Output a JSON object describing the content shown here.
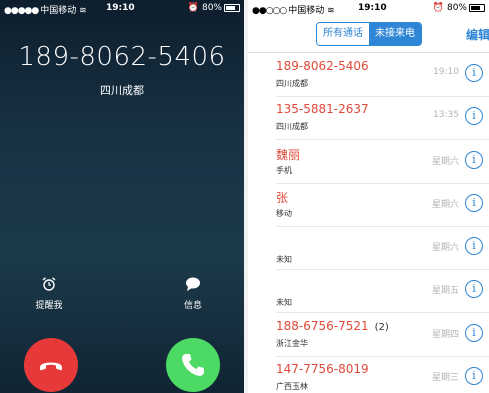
{
  "incoming": {
    "status": {
      "carrier": "中国移动",
      "time": "19:10",
      "battery": "80%"
    },
    "number": "189-8062-5406",
    "location": "四川成都",
    "actions": [
      {
        "label": "提醒我",
        "icon": "alarm-icon"
      },
      {
        "label": "信息",
        "icon": "message-icon"
      }
    ],
    "decline_icon": "decline-call-icon",
    "accept_icon": "accept-call-icon"
  },
  "recents": {
    "status": {
      "carrier": "中国移动",
      "time": "19:10",
      "battery": "80%"
    },
    "tabs": {
      "all": "所有通话",
      "missed": "未接来电",
      "selected": "missed"
    },
    "edit_label": "编辑",
    "accent_color": "#2f86d6",
    "missed_color": "#e04a3a",
    "entries": [
      {
        "name": "189-8062-5406",
        "count": "",
        "detail": "四川成都",
        "time": "19:10"
      },
      {
        "name": "135-5881-2637",
        "count": "",
        "detail": "四川成都",
        "time": "13:35"
      },
      {
        "name": "魏丽",
        "count": "",
        "detail": "手机",
        "time": "星期六"
      },
      {
        "name": "张",
        "count": "",
        "detail": "移动",
        "time": "星期六"
      },
      {
        "name": "",
        "count": "",
        "detail": "未知",
        "time": "星期六"
      },
      {
        "name": "",
        "count": "",
        "detail": "未知",
        "time": "星期五"
      },
      {
        "name": "188-6756-7521",
        "count": "(2)",
        "detail": "浙江金华",
        "time": "星期四"
      },
      {
        "name": "147-7756-8019",
        "count": "",
        "detail": "广西玉林",
        "time": "星期三"
      }
    ]
  }
}
